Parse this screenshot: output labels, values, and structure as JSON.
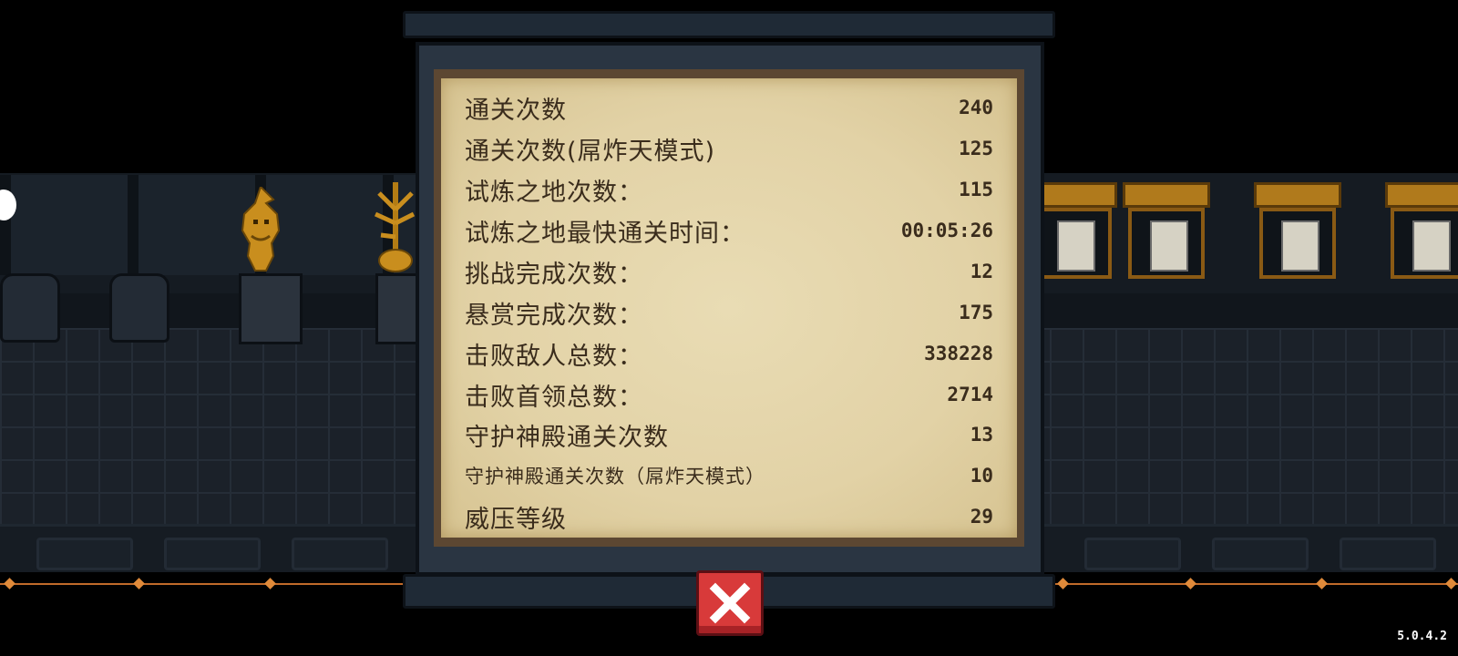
{
  "stats": [
    {
      "label": "通关次数",
      "value": "240"
    },
    {
      "label": "通关次数(屌炸天模式)",
      "value": "125"
    },
    {
      "label": "试炼之地次数：",
      "value": "115"
    },
    {
      "label": "试炼之地最快通关时间：",
      "value": "00:05:26"
    },
    {
      "label": "挑战完成次数：",
      "value": "12"
    },
    {
      "label": "悬赏完成次数：",
      "value": "175"
    },
    {
      "label": "击败敌人总数：",
      "value": "338228"
    },
    {
      "label": "击败首领总数：",
      "value": "2714"
    },
    {
      "label": "守护神殿通关次数",
      "value": "13"
    },
    {
      "label": "守护神殿通关次数（屌炸天模式）",
      "value": "10"
    },
    {
      "label": "威压等级",
      "value": "29"
    }
  ],
  "close_icon": "close-x-icon",
  "version": "5.0.4.2",
  "colors": {
    "paper": "#e6d7ab",
    "text": "#3a2c1c",
    "close_button": "#d83a3a",
    "board": "#2a3542"
  }
}
